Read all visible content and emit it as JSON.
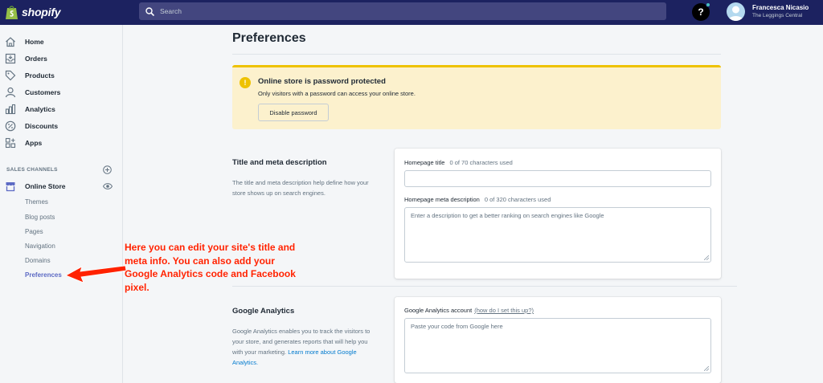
{
  "topbar": {
    "logo_text": "shopify",
    "search_placeholder": "Search",
    "help_glyph": "?",
    "user_name": "Francesca Nicasio",
    "user_store": "The Leggings Central"
  },
  "sidebar": {
    "items": [
      {
        "label": "Home",
        "icon": "home-icon"
      },
      {
        "label": "Orders",
        "icon": "orders-icon"
      },
      {
        "label": "Products",
        "icon": "tag-icon"
      },
      {
        "label": "Customers",
        "icon": "person-icon"
      },
      {
        "label": "Analytics",
        "icon": "bar-chart-icon"
      },
      {
        "label": "Discounts",
        "icon": "discount-icon"
      },
      {
        "label": "Apps",
        "icon": "apps-icon"
      }
    ],
    "sales_channels_title": "SALES CHANNELS",
    "online_store_label": "Online Store",
    "sub_items": [
      "Themes",
      "Blog posts",
      "Pages",
      "Navigation",
      "Domains",
      "Preferences"
    ],
    "active_sub_item": "Preferences"
  },
  "annotation": {
    "text": "Here you can edit your site's title and meta info. You can also add your Google Analytics code  and Facebook pixel."
  },
  "main": {
    "page_title": "Preferences",
    "banner": {
      "icon_glyph": "!",
      "title": "Online store is password protected",
      "text": "Only visitors with a password can access your online store.",
      "button_label": "Disable password"
    },
    "title_meta": {
      "title": "Title and meta description",
      "description": "The title and meta description help define how your store shows up on search engines.",
      "homepage_title_label": "Homepage title",
      "homepage_title_hint": "0 of 70 characters used",
      "homepage_title_value": "",
      "meta_label": "Homepage meta description",
      "meta_hint": "0 of 320 characters used",
      "meta_placeholder": "Enter a description to get a better ranking on search engines like Google"
    },
    "analytics": {
      "title": "Google Analytics",
      "description": "Google Analytics enables you to track the visitors to your store, and generates reports that will help you with your marketing.",
      "learn_more": "Learn more about Google Analytics.",
      "account_label": "Google Analytics account",
      "account_hint": "(how do I set this up?)",
      "code_placeholder": "Paste your code from Google here"
    }
  },
  "colors": {
    "topbar": "#1c2260",
    "active": "#5c6ac4",
    "banner_bg": "#fcf1cd",
    "banner_accent": "#eec200",
    "annotation": "#ff2200",
    "link": "#007ace"
  }
}
